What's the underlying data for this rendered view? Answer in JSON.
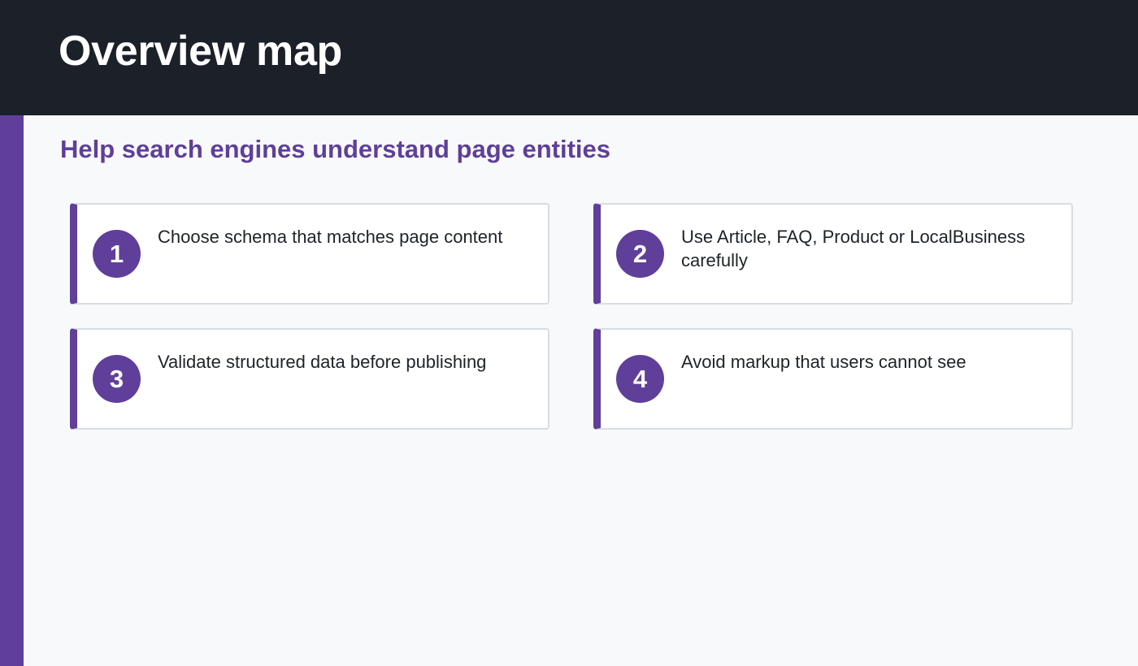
{
  "header": {
    "title": "Overview map"
  },
  "subtitle": "Help search engines understand page entities",
  "colors": {
    "header_bg": "#1b2029",
    "accent": "#5f3f99",
    "page_bg": "#f8f9fb",
    "card_border": "#d8dde3",
    "text": "#1e2329"
  },
  "cards": [
    {
      "number": "1",
      "text": "Choose schema that matches page content"
    },
    {
      "number": "2",
      "text": "Use Article, FAQ, Product or LocalBusiness carefully"
    },
    {
      "number": "3",
      "text": "Validate structured data before publishing"
    },
    {
      "number": "4",
      "text": "Avoid markup that users cannot see"
    }
  ]
}
